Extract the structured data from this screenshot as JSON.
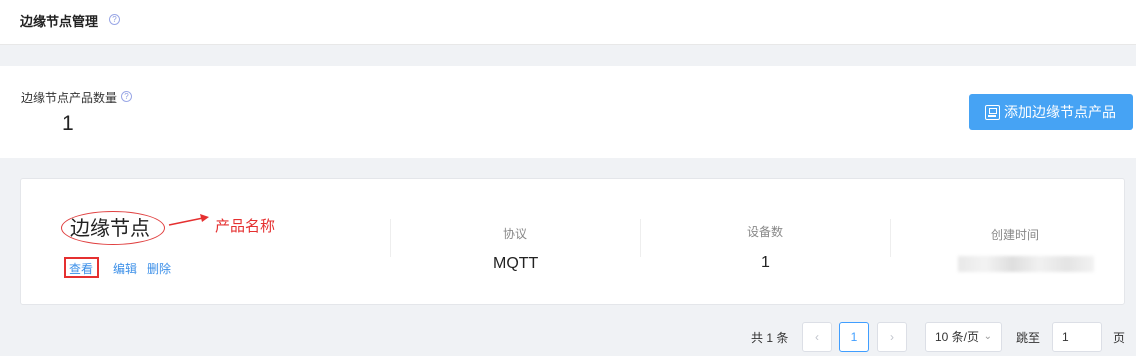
{
  "header": {
    "title": "边缘节点管理",
    "help_icon": "question-circle-icon"
  },
  "summary": {
    "count_label": "边缘节点产品数量",
    "count_value": "1",
    "add_button_label": "添加边缘节点产品",
    "add_button_icon": "add-product-icon",
    "accent_color": "#46a3f4"
  },
  "product_card": {
    "name": "边缘节点",
    "annotation": "产品名称",
    "annotation_color": "#e53030",
    "actions": {
      "view": "查看",
      "edit": "编辑",
      "delete": "删除"
    },
    "columns": [
      {
        "label": "协议",
        "value": "MQTT"
      },
      {
        "label": "设备数",
        "value": "1"
      },
      {
        "label": "创建时间",
        "value": ""
      }
    ]
  },
  "pagination": {
    "total_text": "共 1 条",
    "prev_icon": "chevron-left-icon",
    "current_page": "1",
    "next_icon": "chevron-right-icon",
    "page_size": "10 条/页",
    "jump_label": "跳至",
    "jump_value": "1",
    "page_unit": "页"
  }
}
